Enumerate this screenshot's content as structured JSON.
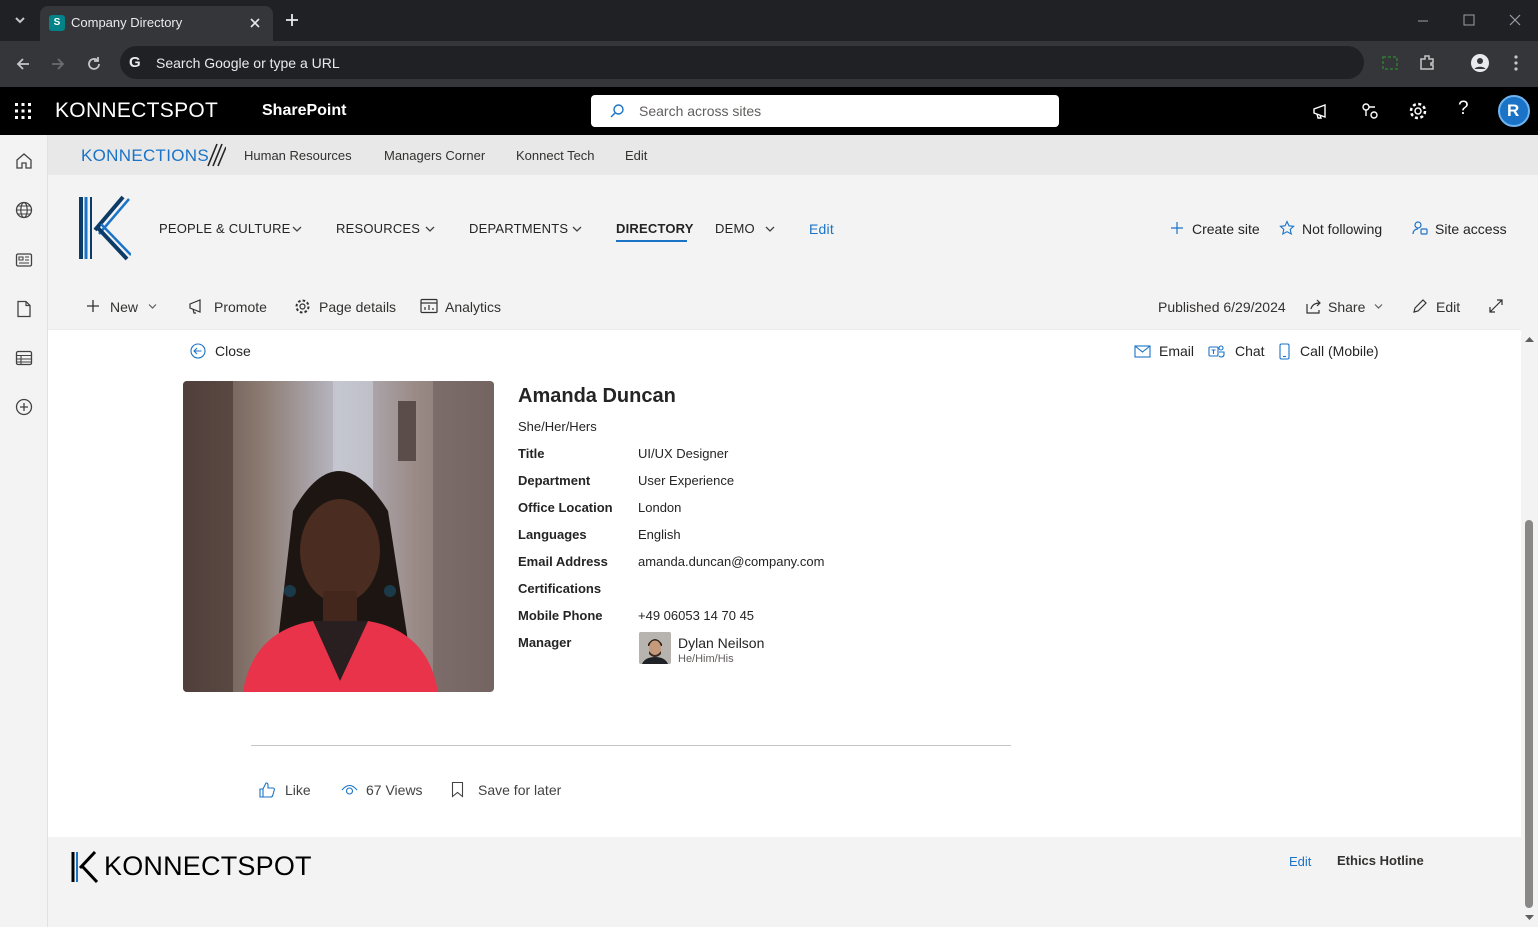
{
  "browser": {
    "tab_title": "Company Directory",
    "address_placeholder": "Search Google or type a URL"
  },
  "suite_bar": {
    "brand": "KONNECTSPOT",
    "app_name": "SharePoint",
    "search_placeholder": "Search across sites"
  },
  "hub_nav": {
    "brand": "KONNECTIONS",
    "links": [
      "Human Resources",
      "Managers Corner",
      "Konnect Tech",
      "Edit"
    ]
  },
  "site_nav": {
    "items": [
      "PEOPLE & CULTURE",
      "RESOURCES",
      "DEPARTMENTS",
      "DIRECTORY",
      "DEMO"
    ],
    "active": "DIRECTORY",
    "edit_label": "Edit",
    "actions": {
      "create_site": "Create site",
      "follow": "Not following",
      "site_access": "Site access"
    }
  },
  "command_bar": {
    "new": "New",
    "promote": "Promote",
    "page_details": "Page details",
    "analytics": "Analytics",
    "published": "Published 6/29/2024",
    "share": "Share",
    "edit": "Edit"
  },
  "profile": {
    "close": "Close",
    "actions": {
      "email": "Email",
      "chat": "Chat",
      "call": "Call (Mobile)"
    },
    "name": "Amanda Duncan",
    "pronouns": "She/Her/Hers",
    "fields": {
      "title": {
        "label": "Title",
        "value": "UI/UX Designer"
      },
      "department": {
        "label": "Department",
        "value": "User Experience"
      },
      "office": {
        "label": "Office Location",
        "value": "London"
      },
      "languages": {
        "label": "Languages",
        "value": "English"
      },
      "email": {
        "label": "Email Address",
        "value": "amanda.duncan@company.com"
      },
      "certifications": {
        "label": "Certifications",
        "value": ""
      },
      "mobile": {
        "label": "Mobile Phone",
        "value": "+49 06053 14 70 45"
      },
      "manager": {
        "label": "Manager",
        "name": "Dylan Neilson",
        "pronouns": "He/Him/His"
      }
    }
  },
  "page_footer_actions": {
    "like": "Like",
    "views": "67 Views",
    "save": "Save for later"
  },
  "footer": {
    "brand": "KONNECTSPOT",
    "edit": "Edit",
    "ethics": "Ethics Hotline"
  },
  "colors": {
    "accent": "#1a73c7",
    "suite_bar": "#000000",
    "accent_red": "#e8334a"
  }
}
